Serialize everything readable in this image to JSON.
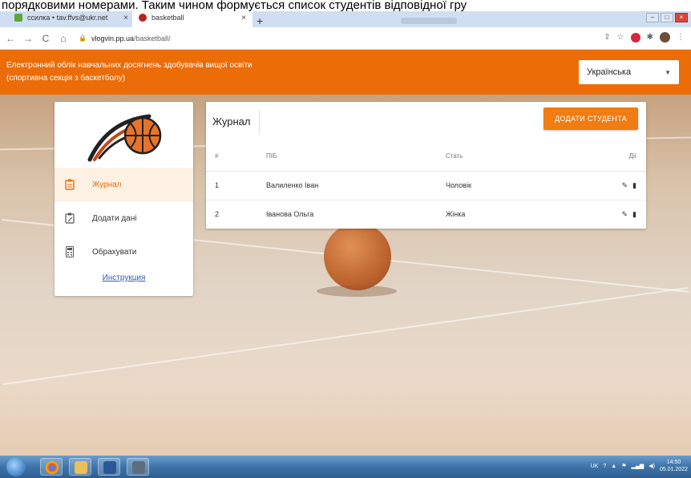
{
  "doc_caption": "порядковими номерами. Таким чином формується список студентів відповідної гру",
  "browser": {
    "tabs": [
      {
        "label": "ссилка • tav.ffvs@ukr.net",
        "close": "×"
      },
      {
        "label": "basketball",
        "close": "×"
      }
    ],
    "new_tab": "+",
    "url_host": "vlogvin.pp.ua",
    "url_path": "/basketball/"
  },
  "header": {
    "title_line1": "Електронний облік навчальних досягнень здобувачів вищої освіти",
    "title_line2": "(спортивна секція з баскетболу)",
    "language": "Українська"
  },
  "sidebar": {
    "items": [
      {
        "label": "Журнал",
        "icon": "clipboard-icon",
        "active": true
      },
      {
        "label": "Додати дані",
        "icon": "clipboard-edit-icon",
        "active": false
      },
      {
        "label": "Обрахувати",
        "icon": "calculator-icon",
        "active": false
      }
    ],
    "help_link": "Инструкция"
  },
  "main": {
    "title": "Журнал",
    "add_button": "ДОДАТИ СТУДЕНТА",
    "columns": [
      "#",
      "ПІБ",
      "Стать",
      "Дії"
    ],
    "rows": [
      {
        "num": "1",
        "name": "Валиленко Іван",
        "sex": "Чоловік"
      },
      {
        "num": "2",
        "name": "Іванова Ольга",
        "sex": "Жінка"
      }
    ]
  },
  "taskbar": {
    "lang": "UK",
    "time": "14:50",
    "date": "05.01.2022"
  },
  "colors": {
    "accent": "#ec6c08",
    "button": "#f07c12",
    "link": "#3a5ab8"
  }
}
